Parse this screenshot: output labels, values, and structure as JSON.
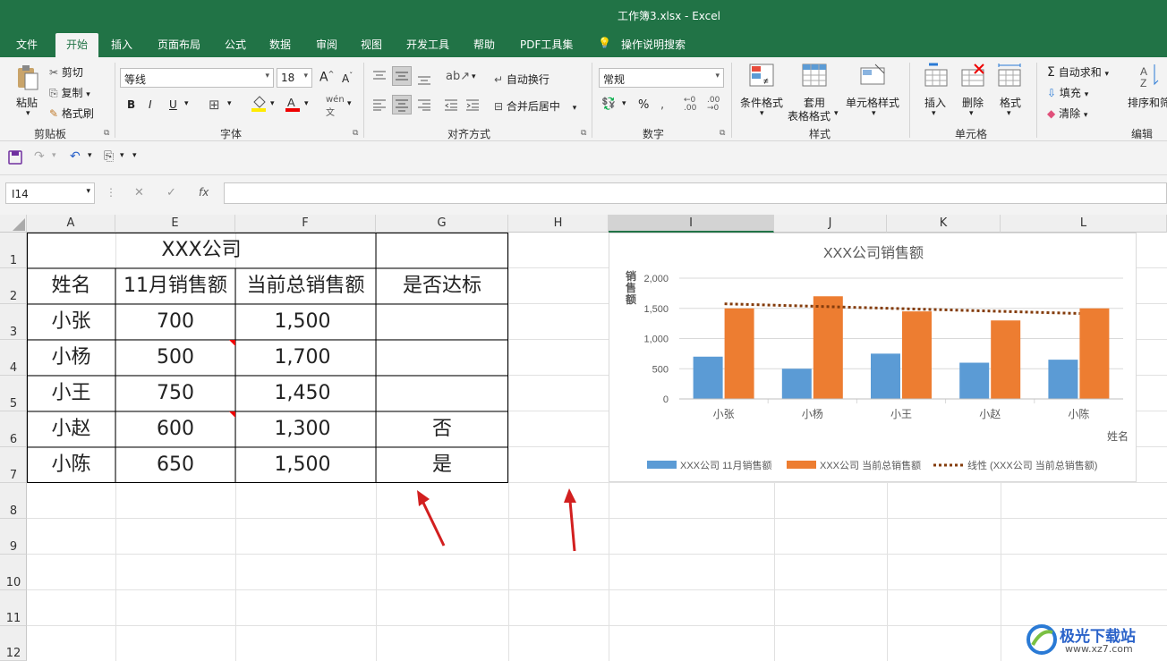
{
  "window": {
    "title": "工作簿3.xlsx  -  Excel"
  },
  "tabs": [
    "文件",
    "开始",
    "插入",
    "页面布局",
    "公式",
    "数据",
    "审阅",
    "视图",
    "开发工具",
    "帮助",
    "PDF工具集",
    "操作说明搜索"
  ],
  "ribbon": {
    "clipboard": {
      "paste": "粘贴",
      "cut": "剪切",
      "copy": "复制",
      "format_painter": "格式刷",
      "label": "剪贴板"
    },
    "font": {
      "name": "等线",
      "size": "18",
      "label": "字体",
      "bold": "B",
      "italic": "I",
      "underline": "U",
      "grow": "A",
      "shrink": "A"
    },
    "alignment": {
      "wrap": "自动换行",
      "merge": "合并后居中",
      "label": "对齐方式"
    },
    "number": {
      "format": "常规",
      "percent": "%",
      "label": "数字"
    },
    "styles": {
      "conditional": "条件格式",
      "table_line1": "套用",
      "table_line2": "表格格式",
      "cell_styles": "单元格样式",
      "label": "样式"
    },
    "cells": {
      "insert": "插入",
      "delete": "删除",
      "format": "格式",
      "label": "单元格"
    },
    "editing": {
      "autosum": "自动求和",
      "fill": "填充",
      "clear": "清除",
      "sort": "排序和筛",
      "label": "编辑"
    }
  },
  "formula_bar": {
    "name_box": "I14",
    "fx": "fx",
    "value": ""
  },
  "columns": [
    "A",
    "E",
    "F",
    "G",
    "H",
    "I",
    "J",
    "K",
    "L"
  ],
  "rows": [
    "1",
    "2",
    "3",
    "4",
    "5",
    "6",
    "7",
    "8",
    "9",
    "10",
    "11",
    "12"
  ],
  "sheet": {
    "title": "XXX公司",
    "headers": [
      "姓名",
      "11月销售额",
      "当前总销售额",
      "是否达标"
    ],
    "data": [
      [
        "小张",
        "700",
        "1,500",
        ""
      ],
      [
        "小杨",
        "500",
        "1,700",
        ""
      ],
      [
        "小王",
        "750",
        "1,450",
        ""
      ],
      [
        "小赵",
        "600",
        "1,300",
        "否"
      ],
      [
        "小陈",
        "650",
        "1,500",
        "是"
      ]
    ]
  },
  "chart_data": {
    "type": "bar",
    "title": "XXX公司销售额",
    "xlabel": "姓名",
    "ylabel": "销售额",
    "categories": [
      "小张",
      "小杨",
      "小王",
      "小赵",
      "小陈"
    ],
    "series": [
      {
        "name": "XXX公司 11月销售额",
        "values": [
          700,
          500,
          750,
          600,
          650
        ],
        "color": "#5b9bd5"
      },
      {
        "name": "XXX公司 当前总销售额",
        "values": [
          1500,
          1700,
          1450,
          1300,
          1500
        ],
        "color": "#ed7d31"
      }
    ],
    "trendline": {
      "name": "线性 (XXX公司 当前总销售额)",
      "start": 1575,
      "end": 1415,
      "color": "#843c0c"
    },
    "yticks": [
      "0",
      "500",
      "1,000",
      "1,500",
      "2,000"
    ],
    "ylim": [
      0,
      2000
    ],
    "legend": "bottom",
    "grid": true
  },
  "watermark": {
    "text": "极光下载站",
    "url": "www.xz7.com"
  },
  "colors": {
    "excel_green": "#217346",
    "arrow": "#d21f1f"
  }
}
